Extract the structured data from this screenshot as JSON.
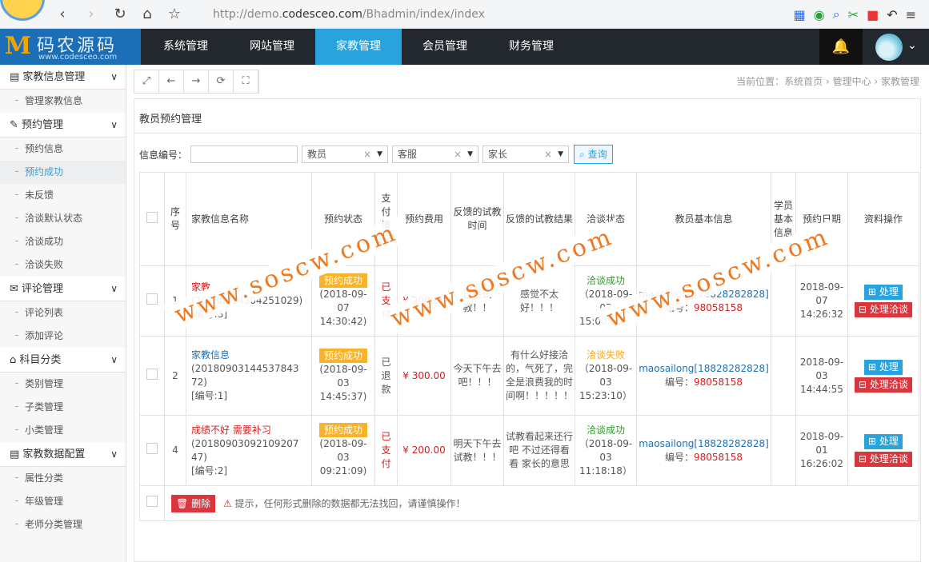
{
  "browser": {
    "url_prefix": "http://demo.",
    "url_domain": "codesceo.com",
    "url_path": "/Bhadmin/index/index"
  },
  "brand": {
    "title": "码农源码",
    "subtitle": "www.codesceo.com",
    "mark": "M"
  },
  "topmenu": [
    "系统管理",
    "网站管理",
    "家教管理",
    "会员管理",
    "财务管理"
  ],
  "sidebar": {
    "groups": [
      {
        "label": "家教信息管理",
        "items": [
          "管理家教信息"
        ]
      },
      {
        "label": "预约管理",
        "items": [
          "预约信息",
          "预约成功",
          "未反馈",
          "洽谈默认状态",
          "洽谈成功",
          "洽谈失败"
        ]
      },
      {
        "label": "评论管理",
        "items": [
          "评论列表",
          "添加评论"
        ]
      },
      {
        "label": "科目分类",
        "items": [
          "类别管理",
          "子类管理",
          "小类管理"
        ]
      },
      {
        "label": "家教数据配置",
        "items": [
          "属性分类",
          "年级管理",
          "老师分类管理"
        ]
      }
    ]
  },
  "breadcrumb": "当前位置：系统首页 › 管理中心 › 家教管理",
  "panel_title": "教员预约管理",
  "filter": {
    "label": "信息编号：",
    "sel1": "教员",
    "sel2": "客服",
    "sel3": "家长",
    "query": "查询"
  },
  "table": {
    "headers": [
      "序号",
      "家教信息名称",
      "预约状态",
      "支付情况",
      "预约费用",
      "反馈的试教时间",
      "反馈的试教结果",
      "洽谈状态",
      "教员基本信息",
      "学员基本信息",
      "预约日期",
      "资料操作"
    ],
    "rows": [
      {
        "no": "1",
        "name": "家教",
        "name_code": "(20180914304251029)",
        "name_id": "[编号:3]",
        "status": "预约成功",
        "status_time": "(2018-09-07 14:30:42)",
        "pay": "已支付",
        "fee": "¥ 200.00",
        "trial_time": "已经试教！！",
        "trial_result": "感觉不太好！！！",
        "talk": "洽谈成功",
        "talk_time": "（2018-09-07 15:00:00）",
        "teacher": "maosailong[18828282828]",
        "teacher_id_label": "编号：",
        "teacher_id": "98058158",
        "date": "2018-09-07 14:26:32"
      },
      {
        "no": "2",
        "name": "家教信息",
        "name_code": "(20180903144537843 72)",
        "name_id": "[编号:1]",
        "status": "预约成功",
        "status_time": "(2018-09-03 14:45:37)",
        "pay": "已退款",
        "fee": "¥ 300.00",
        "trial_time": "今天下午去吧！！！",
        "trial_result": "有什么好接洽的，气死了，完全是浪费我的时间啊！！！！！",
        "talk": "洽谈失败",
        "talk_time": "（2018-09-03 15:23:10）",
        "teacher": "maosailong[18828282828]",
        "teacher_id_label": "编号：",
        "teacher_id": "98058158",
        "date": "2018-09-03 14:44:55"
      },
      {
        "no": "4",
        "name": "成绩不好 需要补习",
        "name_code": "(20180903092109207 47)",
        "name_id": "[编号:2]",
        "status": "预约成功",
        "status_time": "(2018-09-03 09:21:09)",
        "pay": "已支付",
        "fee": "¥ 200.00",
        "trial_time": "明天下午去试教！！！",
        "trial_result": "试教看起来还行吧 不过还得看看 家长的意思",
        "talk": "洽谈成功",
        "talk_time": "（2018-09-03 11:18:18）",
        "teacher": "maosailong[18828282828]",
        "teacher_id_label": "编号：",
        "teacher_id": "98058158",
        "date": "2018-09-01 16:26:02"
      }
    ],
    "btn_process": "处理",
    "btn_talk": "处理洽谈",
    "delete": "删除",
    "tip": "提示，任何形式删除的数据都无法找回，请谨慎操作！"
  },
  "watermark": "www.soscw.com"
}
